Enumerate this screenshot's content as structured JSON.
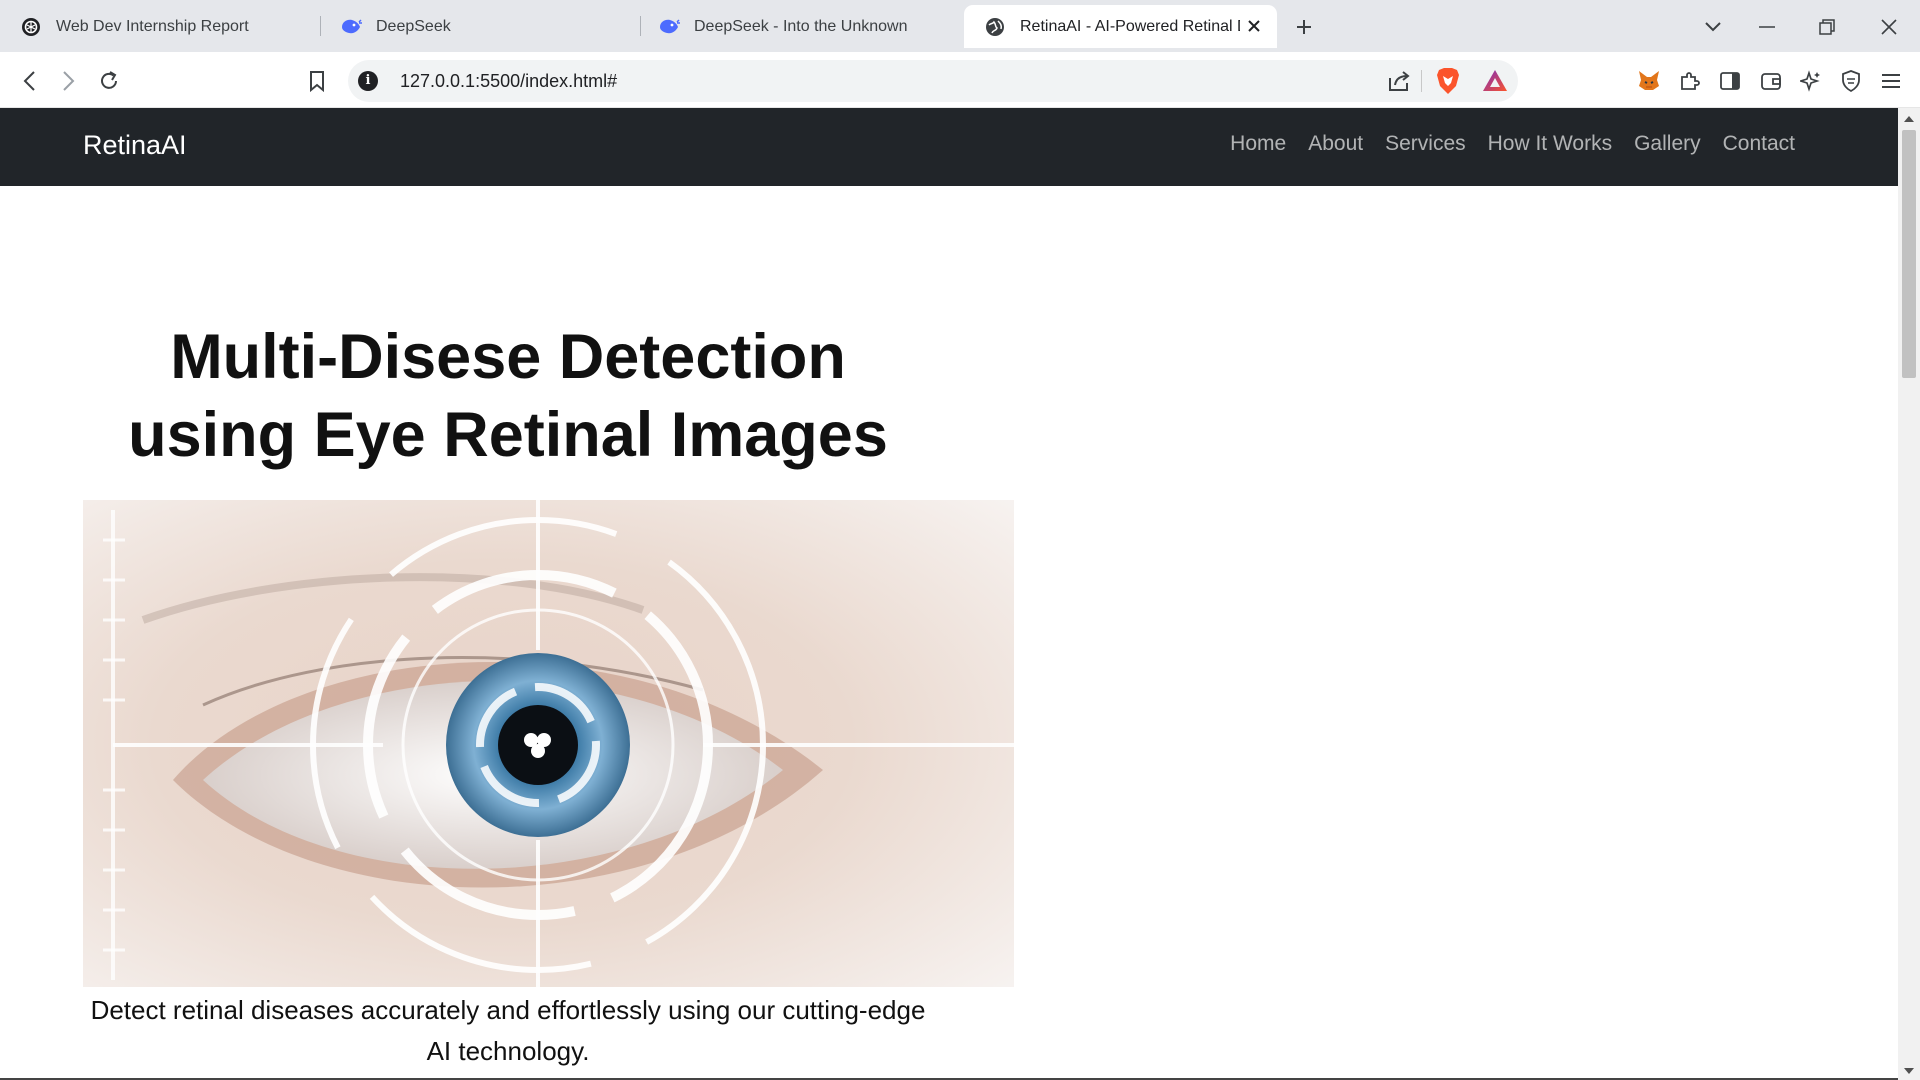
{
  "browser": {
    "tabs": [
      {
        "title": "Web Dev Internship Report",
        "icon": "chatgpt-icon"
      },
      {
        "title": "DeepSeek",
        "icon": "deepseek-whale-icon"
      },
      {
        "title": "DeepSeek - Into the Unknown",
        "icon": "deepseek-whale-icon"
      },
      {
        "title": "RetinaAI - AI-Powered Retinal Disc",
        "icon": "globe-icon",
        "active": true
      }
    ],
    "url": "127.0.0.1:5500/index.html#",
    "accent": "#4d6bfe",
    "brave_color": "#fb542b"
  },
  "site": {
    "brand": "RetinaAI",
    "nav": [
      "Home",
      "About",
      "Services",
      "How It Works",
      "Gallery",
      "Contact"
    ],
    "nav_bg": "#212529",
    "hero": {
      "title": "Multi-Disese Detection using Eye Retinal Images",
      "subtitle": "Detect retinal diseases accurately and effortlessly using our cutting-edge AI technology."
    }
  }
}
